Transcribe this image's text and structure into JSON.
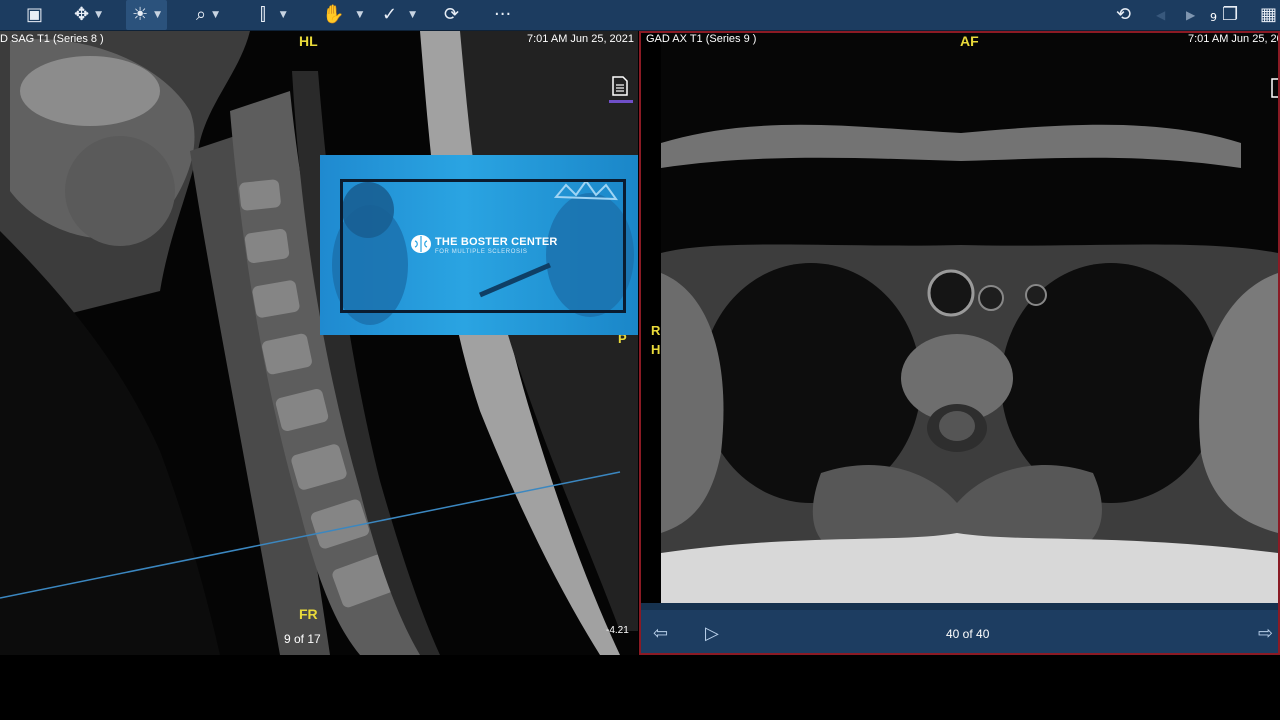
{
  "toolbar": {
    "tools": [
      {
        "name": "export-tool",
        "icon": "save-export-icon",
        "glyph": "▣",
        "caret": "▼"
      },
      {
        "name": "pan-tool",
        "icon": "pan-arrows-icon",
        "glyph": "✥",
        "caret": "▼"
      },
      {
        "name": "window-level-tool",
        "icon": "brightness-icon",
        "glyph": "☀",
        "caret": "▼"
      },
      {
        "name": "zoom-tool",
        "icon": "magnifier-icon",
        "glyph": "⌕",
        "caret": "▼"
      },
      {
        "name": "measure-tool",
        "icon": "ruler-icon",
        "glyph": "⫿",
        "caret": "▼"
      },
      {
        "name": "annotate-tool",
        "icon": "hand-icon",
        "glyph": "✋",
        "caret": "▼"
      },
      {
        "name": "check-tool",
        "icon": "checkmark-icon",
        "glyph": "✓",
        "caret": "▼"
      },
      {
        "name": "sync-tool",
        "icon": "link-sync-icon",
        "glyph": "⟳",
        "caret": ""
      },
      {
        "name": "more-tool",
        "icon": "more-dots-icon",
        "glyph": "···",
        "caret": ""
      }
    ],
    "right_tools": [
      {
        "name": "reset-tool",
        "icon": "refresh-icon",
        "glyph": "⟲"
      },
      {
        "name": "prev-series-tool",
        "icon": "triangle-left-icon",
        "glyph": "◀"
      },
      {
        "name": "next-series-tool",
        "icon": "triangle-right-icon",
        "glyph": "▶"
      },
      {
        "name": "series-stack-tool",
        "icon": "stack-icon",
        "glyph": "❐"
      },
      {
        "name": "layout-tool",
        "icon": "grid-layout-icon",
        "glyph": "▦"
      }
    ],
    "series_count_badge": "9"
  },
  "left_viewport": {
    "series_label": "D SAG T1 (Series 8 )",
    "timestamp": "7:01 AM Jun 25, 2021",
    "orientation_top": "HL",
    "orientation_bottom": "FR",
    "orientation_right": "P",
    "slice_counter": "9 of 17",
    "position_value": "-4.21"
  },
  "ad_overlay": {
    "brand": "THE BOSTER CENTER",
    "subtitle": "FOR MULTIPLE SCLEROSIS",
    "accent": "#2aa4e2"
  },
  "right_viewport": {
    "series_label": "GAD AX T1 (Series 9 )",
    "timestamp": "7:01 AM Jun 25, 20",
    "orientation_top": "AF",
    "orientation_left_1": "R",
    "orientation_left_2": "H",
    "slice_counter": "40 of 40",
    "border_color": "#8b1a24"
  }
}
